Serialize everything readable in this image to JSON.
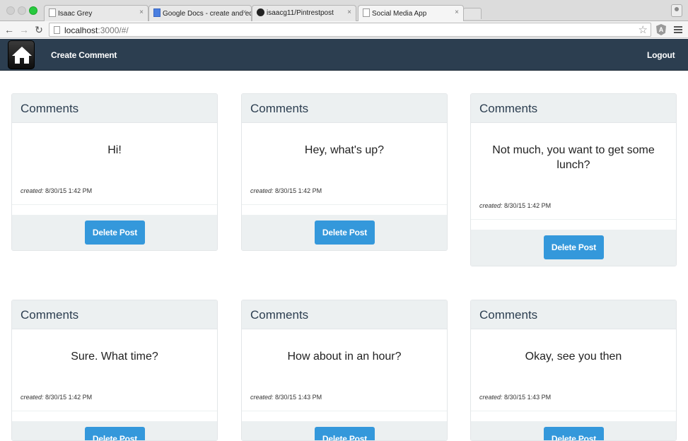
{
  "browser": {
    "tabs": [
      {
        "label": "Isaac Grey",
        "icon": "page-icon",
        "active": false
      },
      {
        "label": "Google Docs - create and edit",
        "icon": "google-docs-icon",
        "active": false
      },
      {
        "label": "isaacg11/Pintrestpost",
        "icon": "github-icon",
        "active": false
      },
      {
        "label": "Social Media App",
        "icon": "page-icon",
        "active": true
      }
    ],
    "tab_close": "×",
    "url_host": "localhost",
    "url_rest": ":3000/#/",
    "back": "←",
    "forward": "→",
    "reload": "↻",
    "star": "☆",
    "ext_badge": "A"
  },
  "navbar": {
    "create_label": "Create Comment",
    "logout_label": "Logout",
    "bg_color": "#2c3e50"
  },
  "cards": [
    {
      "header": "Comments",
      "message": "Hi!",
      "created_label": "created:",
      "created_value": "8/30/15 1:42 PM",
      "button": "Delete Post"
    },
    {
      "header": "Comments",
      "message": "Hey, what's up?",
      "created_label": "created:",
      "created_value": "8/30/15 1:42 PM",
      "button": "Delete Post"
    },
    {
      "header": "Comments",
      "message": "Not much, you want to get some lunch?",
      "created_label": "created:",
      "created_value": "8/30/15 1:42 PM",
      "button": "Delete Post"
    },
    {
      "header": "Comments",
      "message": "Sure. What time?",
      "created_label": "created:",
      "created_value": "8/30/15 1:42 PM",
      "button": "Delete Post"
    },
    {
      "header": "Comments",
      "message": "How about in an hour?",
      "created_label": "created:",
      "created_value": "8/30/15 1:43 PM",
      "button": "Delete Post"
    },
    {
      "header": "Comments",
      "message": "Okay, see you then",
      "created_label": "created:",
      "created_value": "8/30/15 1:43 PM",
      "button": "Delete Post"
    }
  ],
  "colors": {
    "accent": "#3498db",
    "panel": "#ecf0f1"
  }
}
